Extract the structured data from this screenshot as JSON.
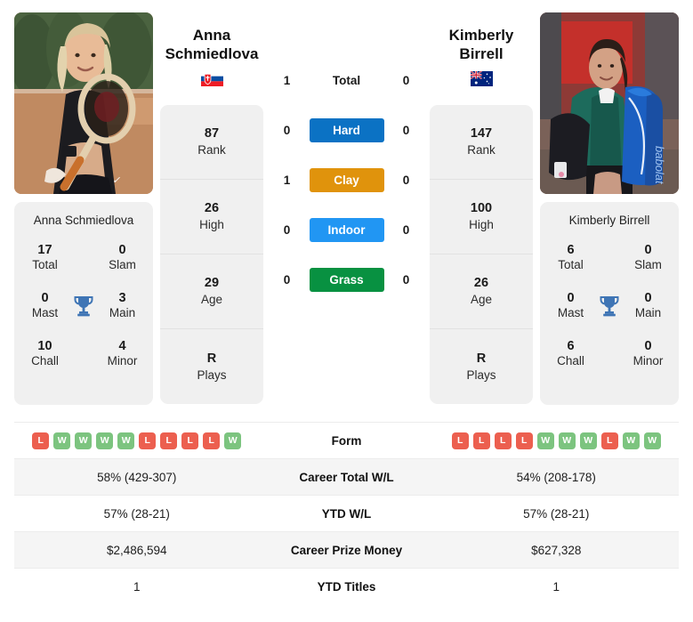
{
  "players": {
    "left": {
      "first_name": "Anna",
      "last_name": "Schmiedlova",
      "full_name": "Anna Schmiedlova",
      "country": "Slovakia",
      "flag_icon": "slovakia-flag-icon",
      "photo_alt": "Anna Schmiedlova holding tennis racket on clay court",
      "rank": "87",
      "rank_label": "Rank",
      "high": "26",
      "high_label": "High",
      "age": "29",
      "age_label": "Age",
      "plays": "R",
      "plays_label": "Plays",
      "titles": {
        "total": "17",
        "total_label": "Total",
        "slam": "0",
        "slam_label": "Slam",
        "mast": "0",
        "mast_label": "Mast",
        "main": "3",
        "main_label": "Main",
        "chall": "10",
        "chall_label": "Chall",
        "minor": "4",
        "minor_label": "Minor"
      },
      "form": [
        "L",
        "W",
        "W",
        "W",
        "W",
        "L",
        "L",
        "L",
        "L",
        "W"
      ],
      "career_total_wl": "58% (429-307)",
      "ytd_wl": "57% (28-21)",
      "career_prize_money": "$2,486,594",
      "ytd_titles": "1"
    },
    "right": {
      "first_name": "Kimberly",
      "last_name": "Birrell",
      "full_name": "Kimberly Birrell",
      "country": "Australia",
      "flag_icon": "australia-flag-icon",
      "photo_alt": "Kimberly Birrell walking with racket bag",
      "rank": "147",
      "rank_label": "Rank",
      "high": "100",
      "high_label": "High",
      "age": "26",
      "age_label": "Age",
      "plays": "R",
      "plays_label": "Plays",
      "titles": {
        "total": "6",
        "total_label": "Total",
        "slam": "0",
        "slam_label": "Slam",
        "mast": "0",
        "mast_label": "Mast",
        "main": "0",
        "main_label": "Main",
        "chall": "6",
        "chall_label": "Chall",
        "minor": "0",
        "minor_label": "Minor"
      },
      "form": [
        "L",
        "L",
        "L",
        "L",
        "W",
        "W",
        "W",
        "L",
        "W",
        "W"
      ],
      "career_total_wl": "54% (208-178)",
      "ytd_wl": "57% (28-21)",
      "career_prize_money": "$627,328",
      "ytd_titles": "1"
    }
  },
  "head_to_head": [
    {
      "label": "Total",
      "left": "1",
      "right": "0",
      "style": "plain",
      "color": ""
    },
    {
      "label": "Hard",
      "left": "0",
      "right": "0",
      "style": "badge",
      "color": "#0b72c4"
    },
    {
      "label": "Clay",
      "left": "1",
      "right": "0",
      "style": "badge",
      "color": "#e0930c"
    },
    {
      "label": "Indoor",
      "left": "0",
      "right": "0",
      "style": "badge",
      "color": "#2196f3"
    },
    {
      "label": "Grass",
      "left": "0",
      "right": "0",
      "style": "badge",
      "color": "#089141"
    }
  ],
  "table_rows": [
    {
      "label": "Form",
      "type": "form"
    },
    {
      "label": "Career Total W/L",
      "type": "text",
      "key": "career_total_wl"
    },
    {
      "label": "YTD W/L",
      "type": "text",
      "key": "ytd_wl"
    },
    {
      "label": "Career Prize Money",
      "type": "text",
      "key": "career_prize_money"
    },
    {
      "label": "YTD Titles",
      "type": "text",
      "key": "ytd_titles"
    }
  ],
  "colors": {
    "win": "#7cc47f",
    "loss": "#ec5f4f",
    "panel": "#f0f0f0",
    "trophy": "#3f75b5"
  }
}
